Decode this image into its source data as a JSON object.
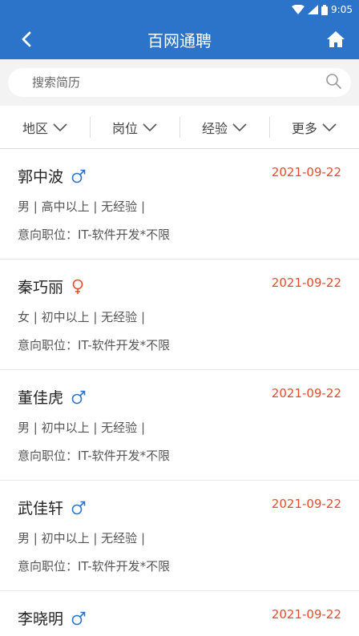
{
  "status": {
    "time": "9:05"
  },
  "nav": {
    "title": "百网通聘"
  },
  "search": {
    "placeholder": "搜索简历"
  },
  "filters": [
    {
      "label": "地区"
    },
    {
      "label": "岗位"
    },
    {
      "label": "经验"
    },
    {
      "label": "更多"
    }
  ],
  "colors": {
    "primary": "#2c74c9",
    "date": "#e84b2c",
    "male": "#2c74c9",
    "female": "#e84b2c"
  },
  "resumes": [
    {
      "name": "郭中波",
      "gender": "male",
      "gender_icon": "male-icon",
      "date": "2021-09-22",
      "meta": "男 | 高中以上 | 无经验 |",
      "intent": "意向职位：IT-软件开发*不限"
    },
    {
      "name": "秦巧丽",
      "gender": "female",
      "gender_icon": "female-icon",
      "date": "2021-09-22",
      "meta": "女 | 初中以上 | 无经验 |",
      "intent": "意向职位：IT-软件开发*不限"
    },
    {
      "name": "董佳虎",
      "gender": "male",
      "gender_icon": "male-icon",
      "date": "2021-09-22",
      "meta": "男 | 初中以上 | 无经验 |",
      "intent": "意向职位：IT-软件开发*不限"
    },
    {
      "name": "武佳轩",
      "gender": "male",
      "gender_icon": "male-icon",
      "date": "2021-09-22",
      "meta": "男 | 初中以上 | 无经验 |",
      "intent": "意向职位：IT-软件开发*不限"
    },
    {
      "name": "李晓明",
      "gender": "male",
      "gender_icon": "male-icon",
      "date": "2021-09-22",
      "meta": "",
      "intent": ""
    }
  ]
}
